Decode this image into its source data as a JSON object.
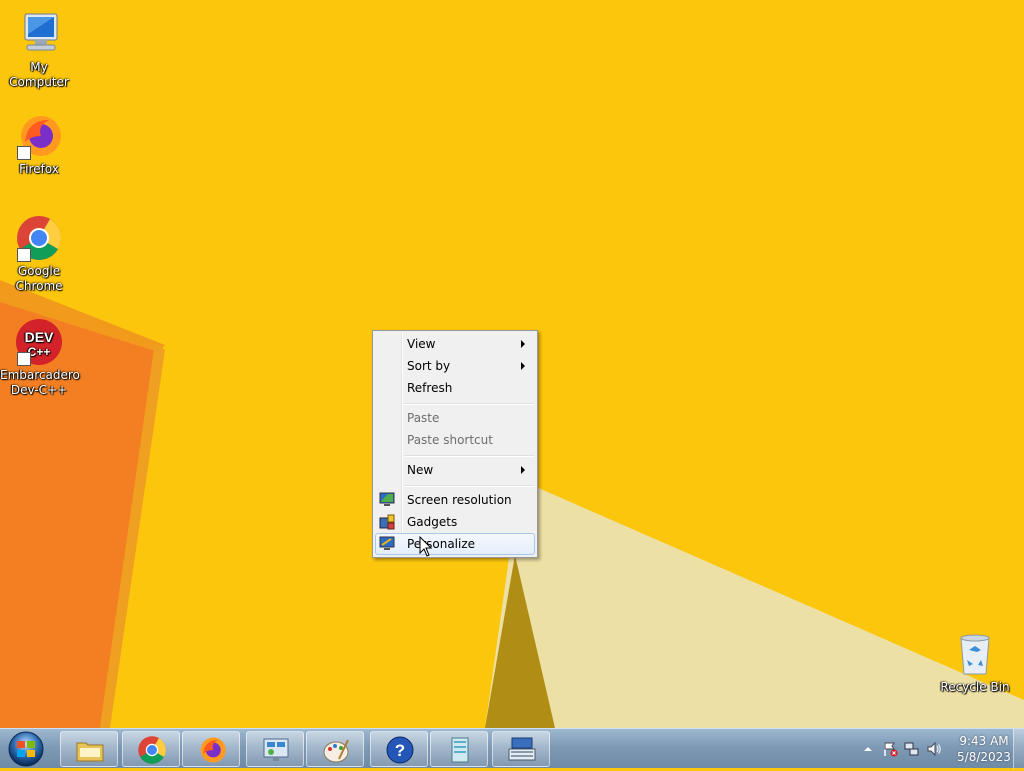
{
  "desktop": {
    "icons": [
      {
        "label": "My Computer",
        "icon": "computer-icon"
      },
      {
        "label": "Firefox",
        "icon": "firefox-icon"
      },
      {
        "label": "Google Chrome",
        "icon": "chrome-icon"
      },
      {
        "label": "Embarcadero Dev-C++",
        "icon": "devcpp-icon"
      },
      {
        "label": "Recycle Bin",
        "icon": "recycle-bin-icon"
      }
    ]
  },
  "context_menu": {
    "items": [
      {
        "label": "View",
        "submenu": true,
        "enabled": true
      },
      {
        "label": "Sort by",
        "submenu": true,
        "enabled": true
      },
      {
        "label": "Refresh",
        "enabled": true
      },
      {
        "label": "Paste",
        "enabled": false
      },
      {
        "label": "Paste shortcut",
        "enabled": false
      },
      {
        "label": "New",
        "submenu": true,
        "enabled": true
      },
      {
        "label": "Screen resolution",
        "icon": "monitor-icon",
        "enabled": true
      },
      {
        "label": "Gadgets",
        "icon": "gadgets-icon",
        "enabled": true
      },
      {
        "label": "Personalize",
        "icon": "personalize-icon",
        "enabled": true,
        "highlighted": true
      }
    ]
  },
  "taskbar": {
    "start_icon": "windows-orb-icon",
    "pinned": [
      {
        "name": "file-explorer",
        "icon": "folder-icon"
      },
      {
        "name": "chrome",
        "icon": "chrome-icon"
      },
      {
        "name": "firefox",
        "icon": "firefox-icon"
      },
      {
        "name": "control-panel",
        "icon": "control-panel-icon"
      },
      {
        "name": "paint",
        "icon": "paint-icon"
      },
      {
        "name": "help",
        "icon": "help-icon"
      },
      {
        "name": "notepad",
        "icon": "notepad-icon"
      },
      {
        "name": "on-screen-keyboard",
        "icon": "keyboard-icon"
      }
    ],
    "tray": {
      "time": "9:43 AM",
      "date": "5/8/2023"
    }
  },
  "colors": {
    "wallpaper": "#fcc60c",
    "accent_orange": "#f7841f"
  }
}
